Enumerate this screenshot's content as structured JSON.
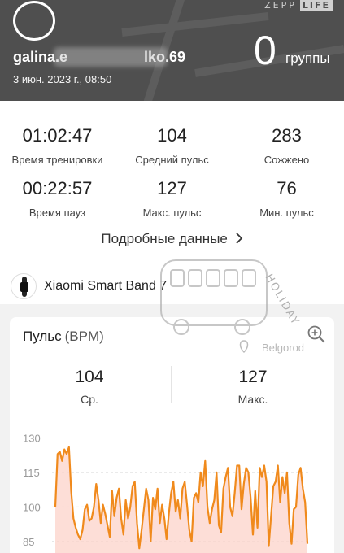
{
  "header": {
    "brand_left": "ZEPP",
    "brand_right": "LIFE",
    "user_name": "galina.e",
    "user_name_tail": "lko.69",
    "date": "3 июн. 2023 г., 08:50",
    "groups_value": "0",
    "groups_label": "группы"
  },
  "stats": [
    {
      "value": "01:02:47",
      "label": "Время тренировки"
    },
    {
      "value": "104",
      "label": "Средний пульс"
    },
    {
      "value": "283",
      "label": "Сожжено"
    },
    {
      "value": "00:22:57",
      "label": "Время пауз"
    },
    {
      "value": "127",
      "label": "Макс. пульс"
    },
    {
      "value": "76",
      "label": "Мин. пульс"
    }
  ],
  "details_link": "Подробные данные",
  "device": {
    "name": "Xiaomi Smart Band 7",
    "icon": "band-icon"
  },
  "heart_card": {
    "title": "Пульс",
    "unit": "(BPM)",
    "avg_value": "104",
    "avg_label": "Ср.",
    "max_value": "127",
    "max_label": "Макс.",
    "zoom_icon": "zoom-in-icon"
  },
  "watermark": {
    "text": "HOLIDAY",
    "city": "Belgorod"
  },
  "colors": {
    "line": "#f08a1c",
    "fill": "#fcd3c9",
    "header": "#4f4f4f"
  },
  "chart_data": {
    "type": "area",
    "title": "",
    "xlabel": "",
    "ylabel": "",
    "y_ticks": [
      "130",
      "115",
      "100",
      "85"
    ],
    "ylim": [
      80,
      133
    ],
    "series": [
      {
        "values": [
          100,
          123,
          124,
          120,
          125,
          123,
          126,
          107,
          95,
          91,
          88,
          86,
          90,
          99,
          101,
          94,
          95,
          100,
          110,
          103,
          93,
          101,
          97,
          92,
          87,
          107,
          96,
          104,
          108,
          95,
          88,
          103,
          95,
          100,
          109,
          111,
          93,
          82,
          90,
          99,
          108,
          103,
          85,
          104,
          99,
          108,
          93,
          101,
          95,
          86,
          97,
          106,
          111,
          98,
          103,
          95,
          108,
          111,
          101,
          90,
          85,
          104,
          106,
          102,
          115,
          109,
          120,
          100,
          93,
          99,
          103,
          115,
          92,
          89,
          108,
          113,
          117,
          100,
          96,
          106,
          118,
          118,
          99,
          110,
          117,
          115,
          104,
          88,
          107,
          91,
          117,
          113,
          118,
          111,
          83,
          96,
          109,
          111,
          118,
          102,
          113,
          106,
          115,
          93,
          84,
          99,
          100,
          114,
          117,
          108,
          102,
          84
        ]
      }
    ]
  }
}
